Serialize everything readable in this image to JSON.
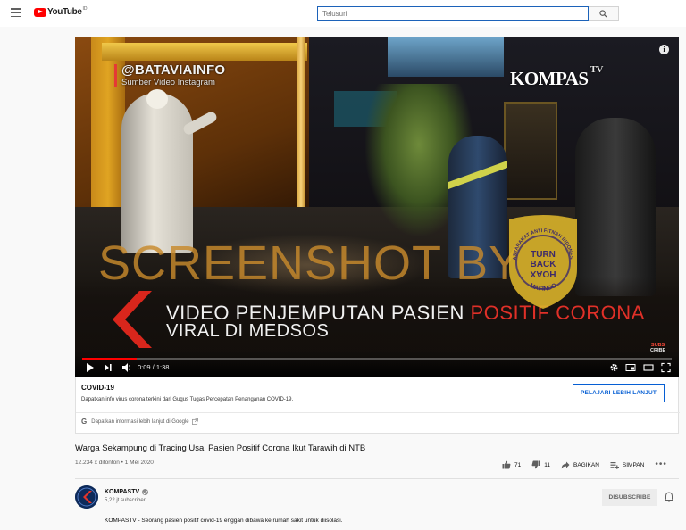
{
  "header": {
    "logo_text": "YouTube",
    "region_code": "ID",
    "search_placeholder": "Telusuri"
  },
  "player": {
    "overlay_handle": "@BATAVIAINFO",
    "overlay_source": "Sumber Video Instagram",
    "broadcaster_logo": "KOMPAS",
    "broadcaster_logo_suffix": "TV",
    "watermark_text": "SCREENSHOT BY",
    "headline_line1_part1": "VIDEO PENJEMPUTAN PASIEN ",
    "headline_line1_accent": "POSITIF CORONA",
    "headline_line2": "VIRAL DI MEDSOS",
    "badge_top_text": "MASYARAKAT ANTI FITNAH INDONESIA",
    "badge_center_line1": "TURN",
    "badge_center_line2": "BACK",
    "badge_center_line3": "HOAX",
    "badge_bottom_text": "MAFINDO",
    "subscribe_mark_line1": "SUBS",
    "subscribe_mark_line2": "CRIBE",
    "info_icon_glyph": "i",
    "time_readout": "0:09 / 1:38",
    "progress": 0.092,
    "accent_color": "#ff0000"
  },
  "info_panel": {
    "title": "COVID-19",
    "description": "Dapatkan info virus corona terkini dari Gugus Tugas Percepatan Penanganan COVID-19.",
    "learn_more_label": "PELAJARI LEBIH LANJUT",
    "google_link": "Dapatkan informasi lebih lanjut di Google"
  },
  "video": {
    "title": "Warga Sekampung di Tracing Usai Pasien Positif Corona Ikut Tarawih di NTB",
    "meta": "12.234 x ditonton • 1 Mei 2020",
    "likes": "71",
    "dislikes": "11",
    "share_label": "BAGIKAN",
    "save_label": "SIMPAN"
  },
  "channel": {
    "name": "KOMPASTV",
    "subscribers": "5,22 jt subscriber",
    "subscribed_label": "DISUBSCRIBE",
    "description": "KOMPASTV - Seorang pasien positif covid-19 enggan dibawa ke rumah sakit untuk diisolasi."
  },
  "icons": {
    "menu": "hamburger-icon",
    "search": "search-icon",
    "play": "play-icon",
    "next": "next-icon",
    "volume": "volume-icon",
    "settings": "gear-icon",
    "miniplayer": "miniplayer-icon",
    "theater": "theater-icon",
    "fullscreen": "fullscreen-icon",
    "like": "thumbs-up-icon",
    "dislike": "thumbs-down-icon",
    "share": "share-icon",
    "save": "playlist-add-icon",
    "more": "more-horizontal-icon",
    "bell": "bell-icon",
    "external": "external-link-icon",
    "verified": "verified-check-icon"
  }
}
